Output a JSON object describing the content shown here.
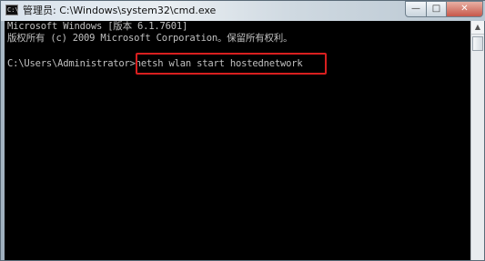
{
  "window": {
    "title": "管理员: C:\\Windows\\system32\\cmd.exe",
    "icon_label": "C:\\",
    "buttons": {
      "minimize": "—",
      "maximize": "□",
      "close": "✕"
    }
  },
  "console": {
    "lines": [
      "Microsoft Windows [版本 6.1.7601]",
      "版权所有 (c) 2009 Microsoft Corporation。保留所有权利。"
    ],
    "prompt": "C:\\Users\\Administrator>",
    "command": "netsh wlan start hostednetwork"
  },
  "colors": {
    "console_bg": "#000000",
    "console_text": "#c0c0c0",
    "highlight_border": "#d81f1f"
  },
  "icons": {
    "app": "cmd-icon",
    "scroll_up": "scroll-up-arrow"
  }
}
